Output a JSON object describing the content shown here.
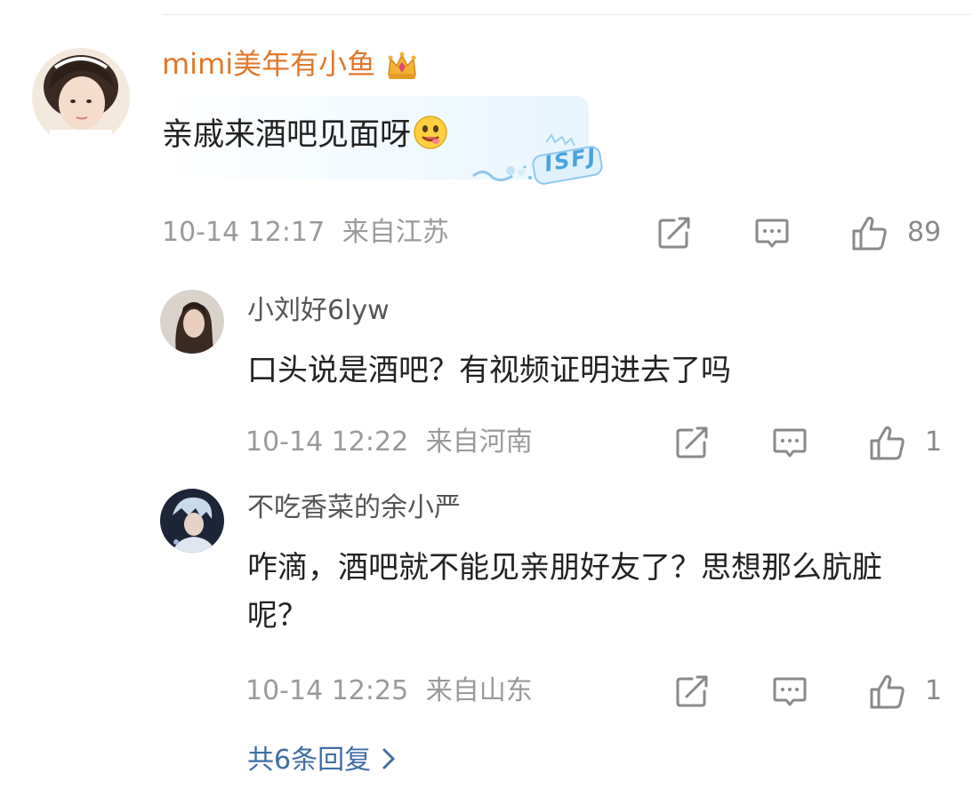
{
  "main_comment": {
    "author": "mimi美年有小鱼",
    "text": "亲戚来酒吧见面呀",
    "sticker_text": "ISFJ",
    "timestamp": "10-14 12:17",
    "location": "来自江苏",
    "like_count": "89",
    "author_color": "#e2782a"
  },
  "replies": [
    {
      "author": "小刘好6lyw",
      "text": "口头说是酒吧？有视频证明进去了吗",
      "timestamp": "10-14 12:22",
      "location": "来自河南",
      "like_count": "1"
    },
    {
      "author": "不吃香菜的余小严",
      "text": "咋滴，酒吧就不能见亲朋好友了？思想那么肮脏呢？",
      "timestamp": "10-14 12:25",
      "location": "来自山东",
      "like_count": "1"
    }
  ],
  "more_replies": {
    "label": "共6条回复",
    "color": "#3f6ea6"
  },
  "icons": [
    "crown-icon",
    "emoji-icon",
    "share-icon",
    "comment-icon",
    "like-icon",
    "chevron-right-icon"
  ]
}
